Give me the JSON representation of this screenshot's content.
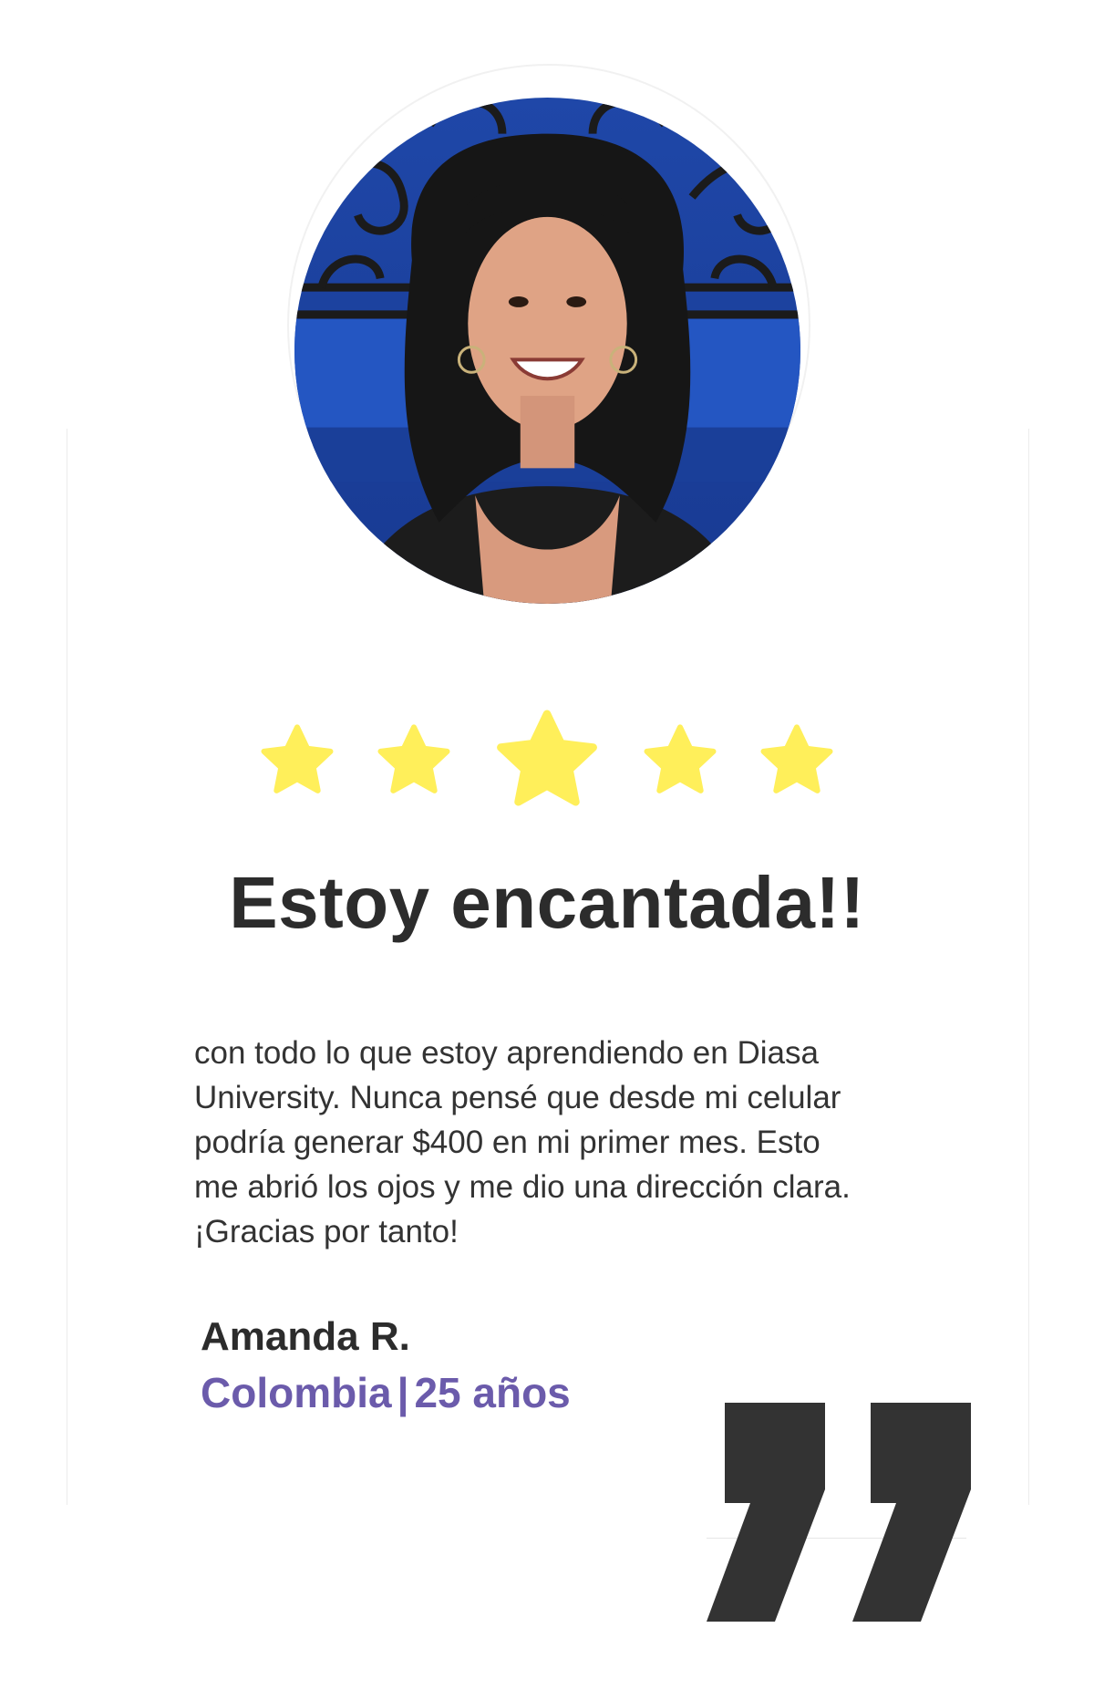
{
  "testimonial": {
    "avatar_icon": "person-photo",
    "rating": 5,
    "rating_max": 5,
    "star_color": "#ffef5a",
    "headline": "Estoy encantada!!",
    "body_lines": [
      "con todo lo que estoy aprendiendo en Diasa",
      "University. Nunca pensé que desde mi celular",
      "podría generar $400 en mi primer mes. Esto",
      "me abrió los ojos y me dio una dirección clara.",
      "¡Gracias por tanto!"
    ],
    "author": "Amanda R.",
    "country": "Colombia",
    "separator": "|",
    "age": "25 años",
    "accent_color": "#6b5bab",
    "quote_icon": "closing-quote-icon"
  }
}
